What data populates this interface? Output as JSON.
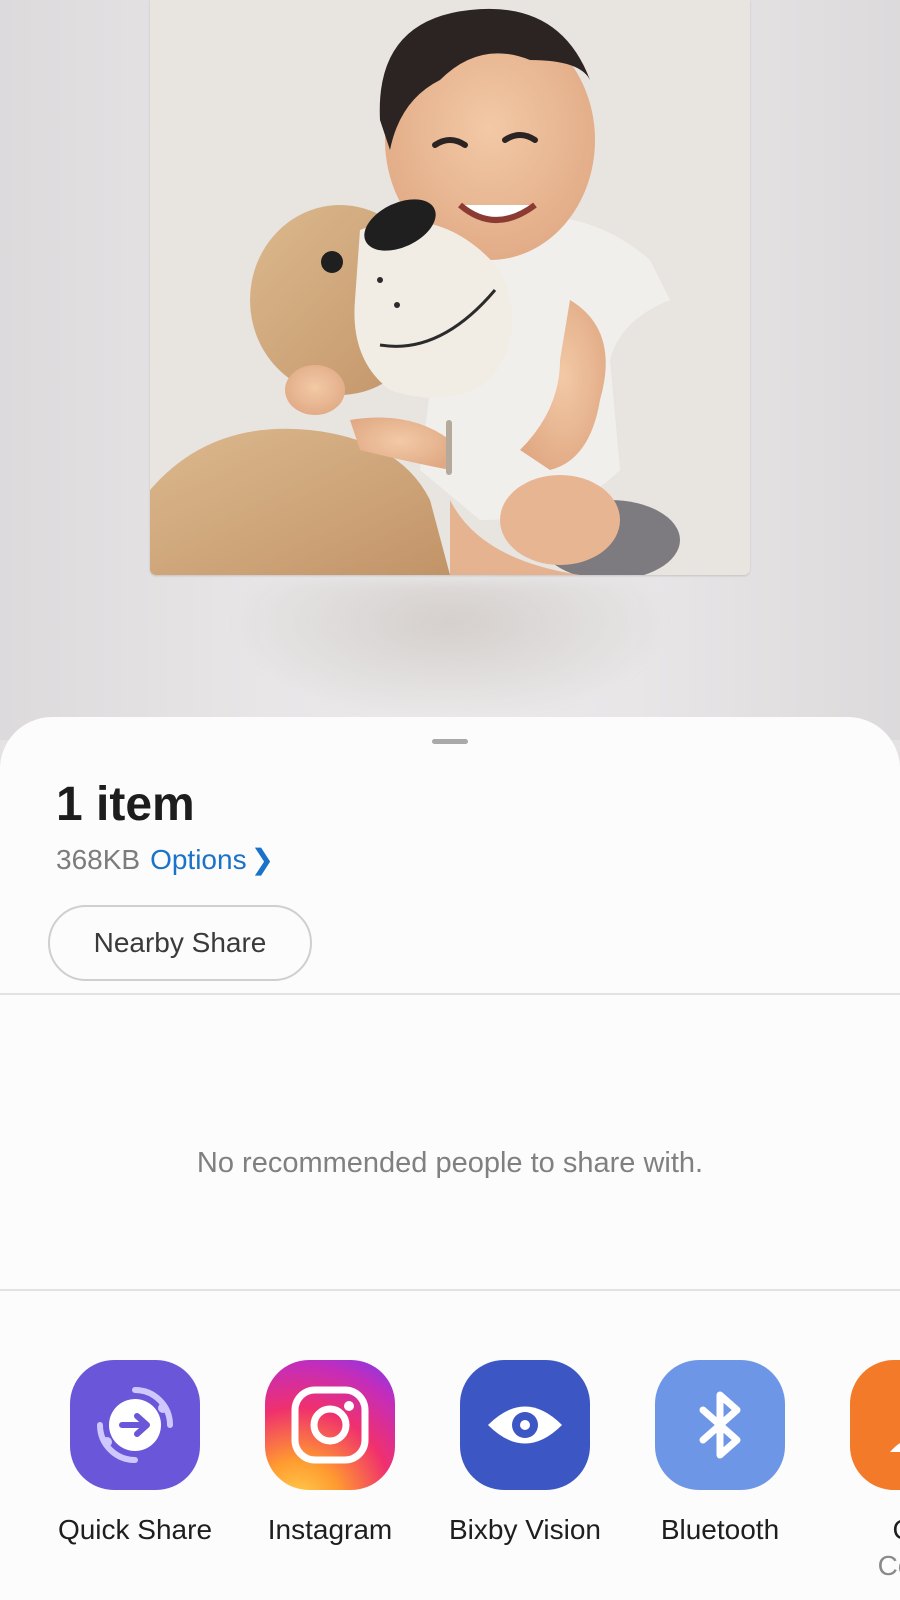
{
  "share_sheet": {
    "title": "1 item",
    "size": "368KB",
    "options_label": "Options",
    "nearby_share_label": "Nearby Share",
    "empty_message": "No recommended people to share with."
  },
  "apps": [
    {
      "label": "Quick Share",
      "icon": "quick-share-icon",
      "color": "#6a56d8"
    },
    {
      "label": "Instagram",
      "icon": "instagram-icon",
      "color": "#e1306c"
    },
    {
      "label": "Bixby Vision",
      "icon": "eye-icon",
      "color": "#3c56c4"
    },
    {
      "label": "Bluetooth",
      "icon": "bluetooth-icon",
      "color": "#6e96e6"
    },
    {
      "label": "Cor",
      "sublabel": "Conta",
      "icon": "contacts-icon",
      "color": "#f27a29"
    }
  ],
  "colors": {
    "accent": "#1a73c8",
    "sheet": "#fcfcfc"
  }
}
